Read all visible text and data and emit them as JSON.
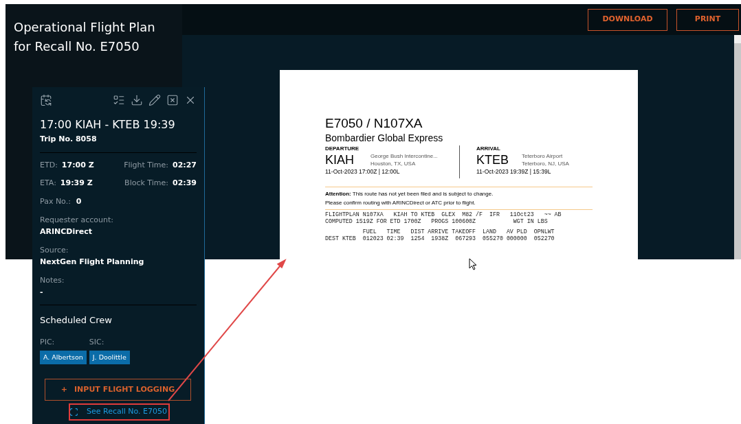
{
  "page_title": [
    "Operational Flight Plan",
    "for Recall No. E7050"
  ],
  "toolbar": {
    "buttons": [
      "DOWNLOAD",
      "PRINT"
    ]
  },
  "document": {
    "heading": "E7050 / N107XA",
    "aircraft": "Bombardier Global Express",
    "legs": [
      {
        "label": "DEPARTURE",
        "code": "KIAH",
        "airport": "George Bush Intercontine...",
        "city": "Houston, TX, USA",
        "time": "11-Oct-2023 17:00Z | 12:00L"
      },
      {
        "label": "ARRIVAL",
        "code": "KTEB",
        "airport": "Teterboro Airport",
        "city": "Teterboro, NJ, USA",
        "time": "11-Oct-2023 19:39Z | 15:39L"
      }
    ],
    "notice": [
      "**Attention:** This route has not yet been filed and is subject to change.",
      "Please confirm routing with ARINCDirect or ATC prior to flight."
    ],
    "plan_blocks": [
      [
        "FLIGHTPLAN N107XA   KIAH TO KTEB  GLEX  M82 /F  IFR   11Oct23   ~~ AB",
        "COMPUTED 1519Z FOR ETD 1700Z   PROGS 100600Z           WGT IN LBS"
      ],
      [
        "           FUEL   TIME   DIST ARRIVE TAKEOFF  LAND   AV PLD  OPNLWT",
        "DEST KTEB  012023 02:39  1254  1938Z  067293  055270 000000  052270"
      ]
    ]
  },
  "flight_panel": {
    "route": "17:00 KIAH - KTEB 19:39",
    "trip": "Trip No. 8058",
    "times": [
      {
        "label": "ETD:",
        "value": "17:00 Z"
      },
      {
        "label": "Flight Time:",
        "value": "02:27"
      },
      {
        "label": "ETA:",
        "value": "19:39 Z"
      },
      {
        "label": "Block Time:",
        "value": "02:39"
      }
    ],
    "pax": {
      "label": "Pax No.:",
      "value": "0"
    },
    "fields": [
      {
        "label": "Requester account:",
        "value": "ARINCDirect"
      },
      {
        "label": "Source:",
        "value": "NextGen Flight Planning"
      },
      {
        "label": "Notes:",
        "value": "-"
      }
    ],
    "crew_title": "Scheduled Crew",
    "crew": [
      {
        "role": "PIC:",
        "name": "A. Albertson"
      },
      {
        "role": "SIC:",
        "name": "J. Doolittle"
      }
    ],
    "log_button": {
      "icon": "+",
      "label": "INPUT FLIGHT LOGGING"
    },
    "recall_link": "See Recall No. E7050"
  }
}
